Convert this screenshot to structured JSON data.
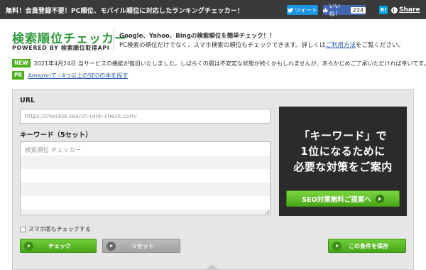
{
  "topbar": {
    "tagline": "無料！会員登録不要！PC順位、モバイル順位に対応したランキングチェッカー！",
    "tweet_label": "ツイート",
    "like_label": "いいね！",
    "like_count": "234",
    "hatena_label": "B!",
    "share_label": "Share"
  },
  "header": {
    "logo_title": "検索順位チェッカー",
    "logo_subtitle": "POWERED BY 検索順位取得API",
    "line1": "Google、Yahoo、Bingの検索順位を簡単チェック！！",
    "line2_prefix": "PC検索の順位だけでなく、スマホ検索の順位もチェックできます。詳しくは",
    "line2_link": "ご利用方法",
    "line2_suffix": "をご覧ください。"
  },
  "news": [
    {
      "badge": "NEW",
      "text": "2021年4月24日  当サービスの機能が復旧いたしました。しばらくの間は不安定な状態が続くかもしれませんが、あらかじめご了承いただければ幸いです。",
      "is_link": false
    },
    {
      "badge": "PR",
      "text": "Amazonで☆4つ以上のSEOの本を探す",
      "is_link": true
    }
  ],
  "form": {
    "url_label": "URL",
    "url_placeholder": "https://checker.search-rank-check.com/",
    "keyword_label": "キーワード（5セット）",
    "keyword_placeholder": "検索順位 チェッカー",
    "mobile_checkbox_label": "スマホ版もチェックする",
    "check_button": "チェック",
    "reset_button": "リセット",
    "save_button": "この条件を保存"
  },
  "promo": {
    "lines": [
      "「キーワード」で",
      "1位になるために",
      "必要な対策をご案内"
    ],
    "button": "SEO対策無料ご提案へ"
  },
  "colors": {
    "accent_green": "#4caf1a",
    "topbar_bg": "#3a3a3a",
    "link_blue": "#2a5db0",
    "panel_bg": "#e6e6e6",
    "promo_bg": "#2b2b2b"
  }
}
